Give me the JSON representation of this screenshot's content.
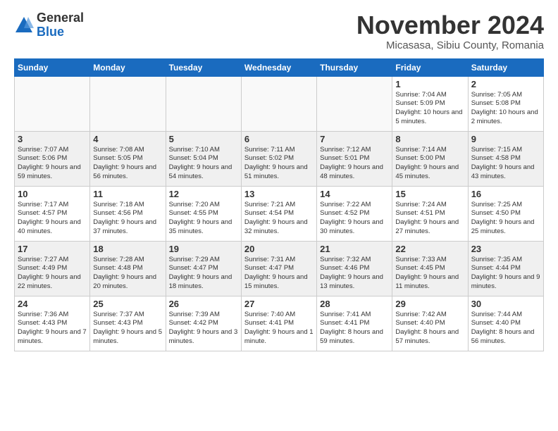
{
  "logo": {
    "general": "General",
    "blue": "Blue"
  },
  "title": "November 2024",
  "location": "Micasasa, Sibiu County, Romania",
  "days_of_week": [
    "Sunday",
    "Monday",
    "Tuesday",
    "Wednesday",
    "Thursday",
    "Friday",
    "Saturday"
  ],
  "weeks": [
    {
      "days": [
        {
          "num": "",
          "empty": true
        },
        {
          "num": "",
          "empty": true
        },
        {
          "num": "",
          "empty": true
        },
        {
          "num": "",
          "empty": true
        },
        {
          "num": "",
          "empty": true
        },
        {
          "num": "1",
          "sunrise": "7:04 AM",
          "sunset": "5:09 PM",
          "daylight": "10 hours and 5 minutes."
        },
        {
          "num": "2",
          "sunrise": "7:05 AM",
          "sunset": "5:08 PM",
          "daylight": "10 hours and 2 minutes."
        }
      ]
    },
    {
      "days": [
        {
          "num": "3",
          "sunrise": "7:07 AM",
          "sunset": "5:06 PM",
          "daylight": "9 hours and 59 minutes."
        },
        {
          "num": "4",
          "sunrise": "7:08 AM",
          "sunset": "5:05 PM",
          "daylight": "9 hours and 56 minutes."
        },
        {
          "num": "5",
          "sunrise": "7:10 AM",
          "sunset": "5:04 PM",
          "daylight": "9 hours and 54 minutes."
        },
        {
          "num": "6",
          "sunrise": "7:11 AM",
          "sunset": "5:02 PM",
          "daylight": "9 hours and 51 minutes."
        },
        {
          "num": "7",
          "sunrise": "7:12 AM",
          "sunset": "5:01 PM",
          "daylight": "9 hours and 48 minutes."
        },
        {
          "num": "8",
          "sunrise": "7:14 AM",
          "sunset": "5:00 PM",
          "daylight": "9 hours and 45 minutes."
        },
        {
          "num": "9",
          "sunrise": "7:15 AM",
          "sunset": "4:58 PM",
          "daylight": "9 hours and 43 minutes."
        }
      ]
    },
    {
      "days": [
        {
          "num": "10",
          "sunrise": "7:17 AM",
          "sunset": "4:57 PM",
          "daylight": "9 hours and 40 minutes."
        },
        {
          "num": "11",
          "sunrise": "7:18 AM",
          "sunset": "4:56 PM",
          "daylight": "9 hours and 37 minutes."
        },
        {
          "num": "12",
          "sunrise": "7:20 AM",
          "sunset": "4:55 PM",
          "daylight": "9 hours and 35 minutes."
        },
        {
          "num": "13",
          "sunrise": "7:21 AM",
          "sunset": "4:54 PM",
          "daylight": "9 hours and 32 minutes."
        },
        {
          "num": "14",
          "sunrise": "7:22 AM",
          "sunset": "4:52 PM",
          "daylight": "9 hours and 30 minutes."
        },
        {
          "num": "15",
          "sunrise": "7:24 AM",
          "sunset": "4:51 PM",
          "daylight": "9 hours and 27 minutes."
        },
        {
          "num": "16",
          "sunrise": "7:25 AM",
          "sunset": "4:50 PM",
          "daylight": "9 hours and 25 minutes."
        }
      ]
    },
    {
      "days": [
        {
          "num": "17",
          "sunrise": "7:27 AM",
          "sunset": "4:49 PM",
          "daylight": "9 hours and 22 minutes."
        },
        {
          "num": "18",
          "sunrise": "7:28 AM",
          "sunset": "4:48 PM",
          "daylight": "9 hours and 20 minutes."
        },
        {
          "num": "19",
          "sunrise": "7:29 AM",
          "sunset": "4:47 PM",
          "daylight": "9 hours and 18 minutes."
        },
        {
          "num": "20",
          "sunrise": "7:31 AM",
          "sunset": "4:47 PM",
          "daylight": "9 hours and 15 minutes."
        },
        {
          "num": "21",
          "sunrise": "7:32 AM",
          "sunset": "4:46 PM",
          "daylight": "9 hours and 13 minutes."
        },
        {
          "num": "22",
          "sunrise": "7:33 AM",
          "sunset": "4:45 PM",
          "daylight": "9 hours and 11 minutes."
        },
        {
          "num": "23",
          "sunrise": "7:35 AM",
          "sunset": "4:44 PM",
          "daylight": "9 hours and 9 minutes."
        }
      ]
    },
    {
      "days": [
        {
          "num": "24",
          "sunrise": "7:36 AM",
          "sunset": "4:43 PM",
          "daylight": "9 hours and 7 minutes."
        },
        {
          "num": "25",
          "sunrise": "7:37 AM",
          "sunset": "4:43 PM",
          "daylight": "9 hours and 5 minutes."
        },
        {
          "num": "26",
          "sunrise": "7:39 AM",
          "sunset": "4:42 PM",
          "daylight": "9 hours and 3 minutes."
        },
        {
          "num": "27",
          "sunrise": "7:40 AM",
          "sunset": "4:41 PM",
          "daylight": "9 hours and 1 minute."
        },
        {
          "num": "28",
          "sunrise": "7:41 AM",
          "sunset": "4:41 PM",
          "daylight": "8 hours and 59 minutes."
        },
        {
          "num": "29",
          "sunrise": "7:42 AM",
          "sunset": "4:40 PM",
          "daylight": "8 hours and 57 minutes."
        },
        {
          "num": "30",
          "sunrise": "7:44 AM",
          "sunset": "4:40 PM",
          "daylight": "8 hours and 56 minutes."
        }
      ]
    }
  ]
}
